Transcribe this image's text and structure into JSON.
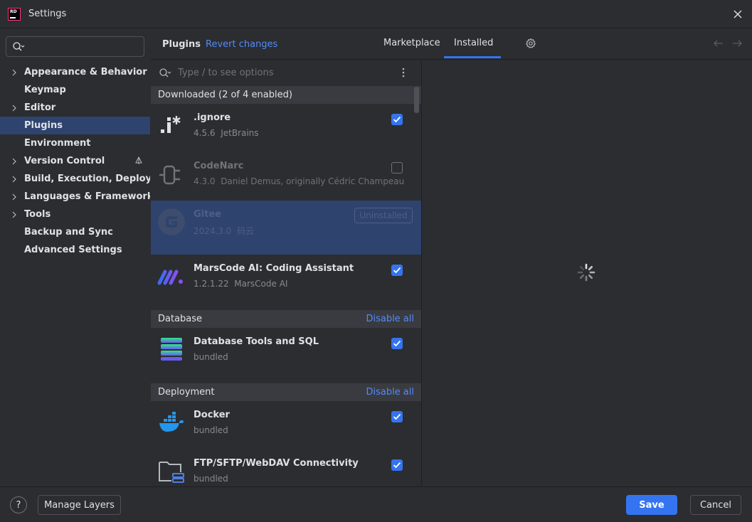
{
  "window": {
    "title": "Settings",
    "app_logo_text": "RD"
  },
  "sidebar": {
    "search": {
      "placeholder": ""
    },
    "items": [
      {
        "label": "Appearance & Behavior",
        "expandable": true
      },
      {
        "label": "Keymap",
        "expandable": false
      },
      {
        "label": "Editor",
        "expandable": true
      },
      {
        "label": "Plugins",
        "expandable": false,
        "selected": true
      },
      {
        "label": "Environment",
        "expandable": false
      },
      {
        "label": "Version Control",
        "expandable": true
      },
      {
        "label": "Build, Execution, Deployment",
        "expandable": true
      },
      {
        "label": "Languages & Frameworks",
        "expandable": true
      },
      {
        "label": "Tools",
        "expandable": true
      },
      {
        "label": "Backup and Sync",
        "expandable": false
      },
      {
        "label": "Advanced Settings",
        "expandable": false
      }
    ]
  },
  "header": {
    "title": "Plugins",
    "revert": "Revert changes",
    "tabs": [
      {
        "label": "Marketplace",
        "active": false
      },
      {
        "label": "Installed",
        "active": true
      }
    ]
  },
  "plugin_list": {
    "search_placeholder": "Type / to see options",
    "sections": {
      "downloaded": {
        "label": "Downloaded (2 of 4 enabled)"
      },
      "database": {
        "label": "Database",
        "action": "Disable all"
      },
      "deployment": {
        "label": "Deployment",
        "action": "Disable all"
      }
    },
    "plugins": {
      "ignore": {
        "name": ".ignore",
        "version": "4.5.6",
        "vendor": "JetBrains",
        "enabled": true
      },
      "codenarc": {
        "name": "CodeNarc",
        "version": "4.3.0",
        "vendor": "Daniel Demus, originally Cédric Champeau",
        "enabled": false
      },
      "gitee": {
        "name": "Gitee",
        "version": "2024.3.0",
        "vendor": "码云",
        "status": "Uninstalled"
      },
      "marscode": {
        "name": "MarsCode AI: Coding Assistant",
        "version": "1.2.1.22",
        "vendor": "MarsCode AI",
        "enabled": true
      },
      "dbtools": {
        "name": "Database Tools and SQL",
        "meta": "bundled",
        "enabled": true
      },
      "docker": {
        "name": "Docker",
        "meta": "bundled",
        "enabled": true
      },
      "ftp": {
        "name": "FTP/SFTP/WebDAV Connectivity",
        "meta": "bundled",
        "enabled": true
      }
    }
  },
  "footer": {
    "help": "?",
    "manage_layers": "Manage Layers",
    "save": "Save",
    "cancel": "Cancel"
  },
  "colors": {
    "background": "#2b2d30",
    "selection": "#2e436e",
    "accent": "#3574f0",
    "link": "#548af7"
  }
}
